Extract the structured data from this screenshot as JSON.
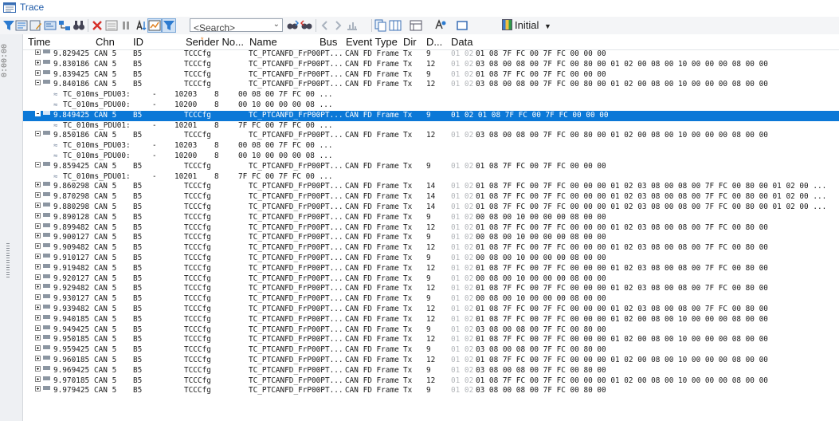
{
  "window": {
    "title": "Trace"
  },
  "toolbar": {
    "search_placeholder": "<Search>",
    "initial_label": "Initial",
    "icons": [
      "filter-icon",
      "filter-list-icon",
      "filter-edit-icon",
      "filter-options-icon",
      "filter-group-icon",
      "binoculars-icon",
      "delete-icon",
      "chart-icon",
      "pause-icon",
      "sort-icon",
      "chart-toggle-icon",
      "filter-active-icon",
      "find-next-icon",
      "find-previous-icon",
      "back-icon",
      "forward-icon",
      "marker-icon",
      "copy-icon",
      "columns-icon",
      "layout-icon",
      "font-color-icon",
      "color-icon",
      "initial-color-icon"
    ]
  },
  "gutter": {
    "time_label": "0:00:00"
  },
  "columns": [
    "Time",
    "Chn",
    "ID",
    "Sender No...",
    "Name",
    "Bus",
    "Event Type",
    "Dir",
    "D...",
    "Data"
  ],
  "rows": [
    {
      "k": "m",
      "t": "9.829425",
      "c": "CAN 5",
      "i": "B5",
      "s": "TCCCfg",
      "n": "TC_PTCANFD_FrP00PT...",
      "e": "CAN FD Frame",
      "dir": "Tx",
      "d": "9",
      "p": "01 02",
      "data": "01 08 7F FC 00 7F FC 00 00 00"
    },
    {
      "k": "m",
      "t": "9.830186",
      "c": "CAN 5",
      "i": "B5",
      "s": "TCCCfg",
      "n": "TC_PTCANFD_FrP00PT...",
      "e": "CAN FD Frame",
      "dir": "Tx",
      "d": "12",
      "p": "01 02",
      "data": "03 08 00 08 00 7F FC 00 80 00 01 02 00 08 00 10 00 00 00 08 00 00"
    },
    {
      "k": "m",
      "t": "9.839425",
      "c": "CAN 5",
      "i": "B5",
      "s": "TCCCfg",
      "n": "TC_PTCANFD_FrP00PT...",
      "e": "CAN FD Frame",
      "dir": "Tx",
      "d": "9",
      "p": "01 02",
      "data": "01 08 7F FC 00 7F FC 00 00 00"
    },
    {
      "k": "m",
      "t": "9.840186",
      "c": "CAN 5",
      "i": "B5",
      "s": "TCCCfg",
      "n": "TC_PTCANFD_FrP00PT...",
      "e": "CAN FD Frame",
      "dir": "Tx",
      "d": "12",
      "p": "01 02",
      "data": "03 08 00 08 00 7F FC 00 80 00 01 02 00 08 00 10 00 00 00 08 00 00",
      "open": true
    },
    {
      "k": "s",
      "name": "TC_010ms_PDU03:",
      "dash": "-",
      "id": "10203",
      "len": "8",
      "val": "00 08 00 7F FC 00 ..."
    },
    {
      "k": "s",
      "name": "TC_010ms_PDU00:",
      "dash": "-",
      "id": "10200",
      "len": "8",
      "val": "00 10 00 00 00 08 ..."
    },
    {
      "k": "m",
      "t": "9.849425",
      "c": "CAN 5",
      "i": "B5",
      "s": "TCCCfg",
      "n": "TC_PTCANFD_FrP00PT...",
      "e": "CAN FD Frame",
      "dir": "Tx",
      "d": "9",
      "p": "",
      "data": "01 02 01 08 7F FC 00 7F FC 00 00 00",
      "open": true,
      "sel": true
    },
    {
      "k": "s",
      "name": "TC_010ms_PDU01:",
      "dash": "-",
      "id": "10201",
      "len": "8",
      "val": "7F FC 00 7F FC 00 ..."
    },
    {
      "k": "m",
      "t": "9.850186",
      "c": "CAN 5",
      "i": "B5",
      "s": "TCCCfg",
      "n": "TC_PTCANFD_FrP00PT...",
      "e": "CAN FD Frame",
      "dir": "Tx",
      "d": "12",
      "p": "01 02",
      "data": "03 08 00 08 00 7F FC 00 80 00 01 02 00 08 00 10 00 00 00 08 00 00",
      "open": true
    },
    {
      "k": "s",
      "name": "TC_010ms_PDU03:",
      "dash": "-",
      "id": "10203",
      "len": "8",
      "val": "00 08 00 7F FC 00 ..."
    },
    {
      "k": "s",
      "name": "TC_010ms_PDU00:",
      "dash": "-",
      "id": "10200",
      "len": "8",
      "val": "00 10 00 00 00 08 ..."
    },
    {
      "k": "m",
      "t": "9.859425",
      "c": "CAN 5",
      "i": "B5",
      "s": "TCCCfg",
      "n": "TC_PTCANFD_FrP00PT...",
      "e": "CAN FD Frame",
      "dir": "Tx",
      "d": "9",
      "p": "01 02",
      "data": "01 08 7F FC 00 7F FC 00 00 00",
      "open": true
    },
    {
      "k": "s",
      "name": "TC_010ms_PDU01:",
      "dash": "-",
      "id": "10201",
      "len": "8",
      "val": "7F FC 00 7F FC 00 ..."
    },
    {
      "k": "m",
      "t": "9.860298",
      "c": "CAN 5",
      "i": "B5",
      "s": "TCCCfg",
      "n": "TC_PTCANFD_FrP00PT...",
      "e": "CAN FD Frame",
      "dir": "Tx",
      "d": "14",
      "p": "01 02",
      "data": "01 08 7F FC 00 7F FC 00 00 00 01 02 03 08 00 08 00 7F FC 00 80 00 01 02 00 ..."
    },
    {
      "k": "m",
      "t": "9.870298",
      "c": "CAN 5",
      "i": "B5",
      "s": "TCCCfg",
      "n": "TC_PTCANFD_FrP00PT...",
      "e": "CAN FD Frame",
      "dir": "Tx",
      "d": "14",
      "p": "01 02",
      "data": "01 08 7F FC 00 7F FC 00 00 00 01 02 03 08 00 08 00 7F FC 00 80 00 01 02 00 ..."
    },
    {
      "k": "m",
      "t": "9.880298",
      "c": "CAN 5",
      "i": "B5",
      "s": "TCCCfg",
      "n": "TC_PTCANFD_FrP00PT...",
      "e": "CAN FD Frame",
      "dir": "Tx",
      "d": "14",
      "p": "01 02",
      "data": "01 08 7F FC 00 7F FC 00 00 00 01 02 03 08 00 08 00 7F FC 00 80 00 01 02 00 ..."
    },
    {
      "k": "m",
      "t": "9.890128",
      "c": "CAN 5",
      "i": "B5",
      "s": "TCCCfg",
      "n": "TC_PTCANFD_FrP00PT...",
      "e": "CAN FD Frame",
      "dir": "Tx",
      "d": "9",
      "p": "01 02",
      "data": "00 08 00 10 00 00 00 08 00 00"
    },
    {
      "k": "m",
      "t": "9.899482",
      "c": "CAN 5",
      "i": "B5",
      "s": "TCCCfg",
      "n": "TC_PTCANFD_FrP00PT...",
      "e": "CAN FD Frame",
      "dir": "Tx",
      "d": "12",
      "p": "01 02",
      "data": "01 08 7F FC 00 7F FC 00 00 00 01 02 03 08 00 08 00 7F FC 00 80 00"
    },
    {
      "k": "m",
      "t": "9.900127",
      "c": "CAN 5",
      "i": "B5",
      "s": "TCCCfg",
      "n": "TC_PTCANFD_FrP00PT...",
      "e": "CAN FD Frame",
      "dir": "Tx",
      "d": "9",
      "p": "01 02",
      "data": "00 08 00 10 00 00 00 08 00 00"
    },
    {
      "k": "m",
      "t": "9.909482",
      "c": "CAN 5",
      "i": "B5",
      "s": "TCCCfg",
      "n": "TC_PTCANFD_FrP00PT...",
      "e": "CAN FD Frame",
      "dir": "Tx",
      "d": "12",
      "p": "01 02",
      "data": "01 08 7F FC 00 7F FC 00 00 00 01 02 03 08 00 08 00 7F FC 00 80 00"
    },
    {
      "k": "m",
      "t": "9.910127",
      "c": "CAN 5",
      "i": "B5",
      "s": "TCCCfg",
      "n": "TC_PTCANFD_FrP00PT...",
      "e": "CAN FD Frame",
      "dir": "Tx",
      "d": "9",
      "p": "01 02",
      "data": "00 08 00 10 00 00 00 08 00 00"
    },
    {
      "k": "m",
      "t": "9.919482",
      "c": "CAN 5",
      "i": "B5",
      "s": "TCCCfg",
      "n": "TC_PTCANFD_FrP00PT...",
      "e": "CAN FD Frame",
      "dir": "Tx",
      "d": "12",
      "p": "01 02",
      "data": "01 08 7F FC 00 7F FC 00 00 00 01 02 03 08 00 08 00 7F FC 00 80 00"
    },
    {
      "k": "m",
      "t": "9.920127",
      "c": "CAN 5",
      "i": "B5",
      "s": "TCCCfg",
      "n": "TC_PTCANFD_FrP00PT...",
      "e": "CAN FD Frame",
      "dir": "Tx",
      "d": "9",
      "p": "01 02",
      "data": "00 08 00 10 00 00 00 08 00 00"
    },
    {
      "k": "m",
      "t": "9.929482",
      "c": "CAN 5",
      "i": "B5",
      "s": "TCCCfg",
      "n": "TC_PTCANFD_FrP00PT...",
      "e": "CAN FD Frame",
      "dir": "Tx",
      "d": "12",
      "p": "01 02",
      "data": "01 08 7F FC 00 7F FC 00 00 00 01 02 03 08 00 08 00 7F FC 00 80 00"
    },
    {
      "k": "m",
      "t": "9.930127",
      "c": "CAN 5",
      "i": "B5",
      "s": "TCCCfg",
      "n": "TC_PTCANFD_FrP00PT...",
      "e": "CAN FD Frame",
      "dir": "Tx",
      "d": "9",
      "p": "01 02",
      "data": "00 08 00 10 00 00 00 08 00 00"
    },
    {
      "k": "m",
      "t": "9.939482",
      "c": "CAN 5",
      "i": "B5",
      "s": "TCCCfg",
      "n": "TC_PTCANFD_FrP00PT...",
      "e": "CAN FD Frame",
      "dir": "Tx",
      "d": "12",
      "p": "01 02",
      "data": "01 08 7F FC 00 7F FC 00 00 00 01 02 03 08 00 08 00 7F FC 00 80 00"
    },
    {
      "k": "m",
      "t": "9.940185",
      "c": "CAN 5",
      "i": "B5",
      "s": "TCCCfg",
      "n": "TC_PTCANFD_FrP00PT...",
      "e": "CAN FD Frame",
      "dir": "Tx",
      "d": "12",
      "p": "01 02",
      "data": "01 08 7F FC 00 7F FC 00 00 00 01 02 00 08 00 10 00 00 00 08 00 00"
    },
    {
      "k": "m",
      "t": "9.949425",
      "c": "CAN 5",
      "i": "B5",
      "s": "TCCCfg",
      "n": "TC_PTCANFD_FrP00PT...",
      "e": "CAN FD Frame",
      "dir": "Tx",
      "d": "9",
      "p": "01 02",
      "data": "03 08 00 08 00 7F FC 00 80 00"
    },
    {
      "k": "m",
      "t": "9.950185",
      "c": "CAN 5",
      "i": "B5",
      "s": "TCCCfg",
      "n": "TC_PTCANFD_FrP00PT...",
      "e": "CAN FD Frame",
      "dir": "Tx",
      "d": "12",
      "p": "01 02",
      "data": "01 08 7F FC 00 7F FC 00 00 00 01 02 00 08 00 10 00 00 00 08 00 00"
    },
    {
      "k": "m",
      "t": "9.959425",
      "c": "CAN 5",
      "i": "B5",
      "s": "TCCCfg",
      "n": "TC_PTCANFD_FrP00PT...",
      "e": "CAN FD Frame",
      "dir": "Tx",
      "d": "9",
      "p": "01 02",
      "data": "03 08 00 08 00 7F FC 00 80 00"
    },
    {
      "k": "m",
      "t": "9.960185",
      "c": "CAN 5",
      "i": "B5",
      "s": "TCCCfg",
      "n": "TC_PTCANFD_FrP00PT...",
      "e": "CAN FD Frame",
      "dir": "Tx",
      "d": "12",
      "p": "01 02",
      "data": "01 08 7F FC 00 7F FC 00 00 00 01 02 00 08 00 10 00 00 00 08 00 00"
    },
    {
      "k": "m",
      "t": "9.969425",
      "c": "CAN 5",
      "i": "B5",
      "s": "TCCCfg",
      "n": "TC_PTCANFD_FrP00PT...",
      "e": "CAN FD Frame",
      "dir": "Tx",
      "d": "9",
      "p": "01 02",
      "data": "03 08 00 08 00 7F FC 00 80 00"
    },
    {
      "k": "m",
      "t": "9.970185",
      "c": "CAN 5",
      "i": "B5",
      "s": "TCCCfg",
      "n": "TC_PTCANFD_FrP00PT...",
      "e": "CAN FD Frame",
      "dir": "Tx",
      "d": "12",
      "p": "01 02",
      "data": "01 08 7F FC 00 7F FC 00 00 00 01 02 00 08 00 10 00 00 00 08 00 00"
    },
    {
      "k": "m",
      "t": "9.979425",
      "c": "CAN 5",
      "i": "B5",
      "s": "TCCCfg",
      "n": "TC_PTCANFD_FrP00PT...",
      "e": "CAN FD Frame",
      "dir": "Tx",
      "d": "9",
      "p": "01 02",
      "data": "03 08 00 08 00 7F FC 00 80 00"
    }
  ],
  "colors": {
    "selection": "#0b78d7",
    "title": "#1e5aa8",
    "dim_prefix": "#b4b7bb",
    "toolbar_bg": "#f4f5f7"
  }
}
